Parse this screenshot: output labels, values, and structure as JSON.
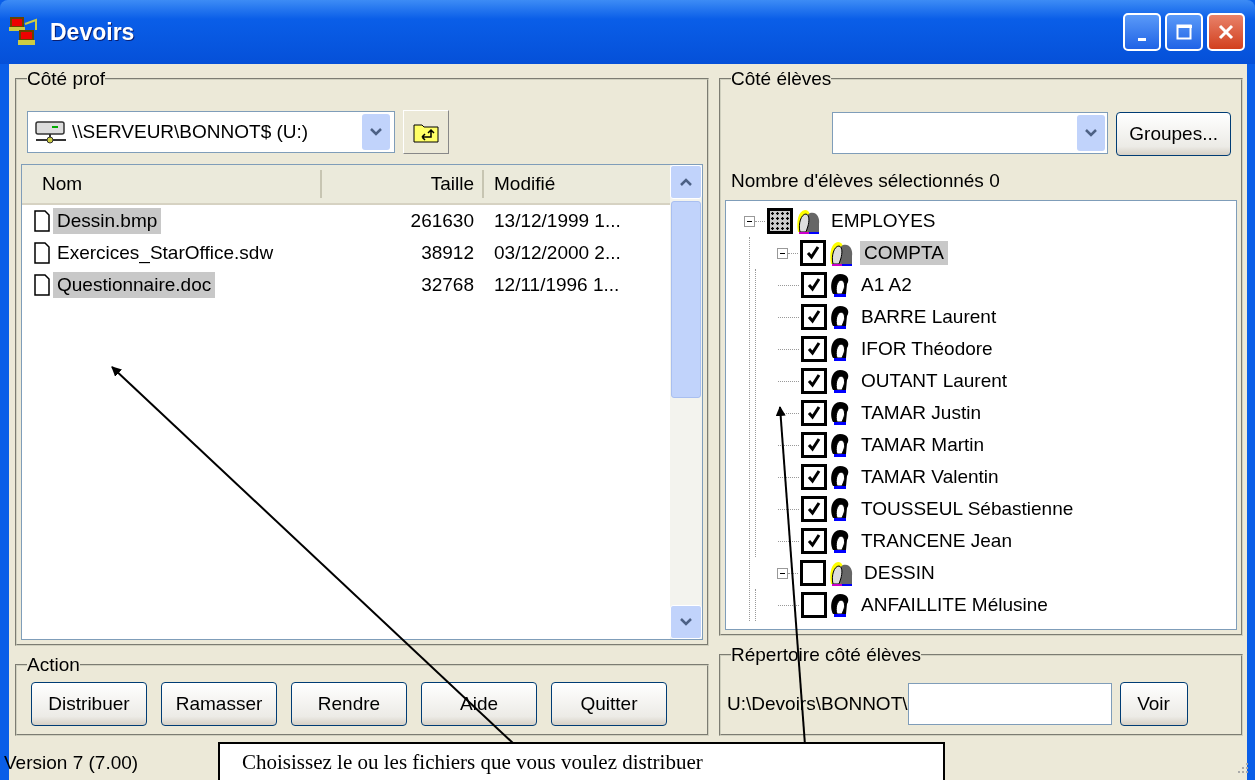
{
  "window": {
    "title": "Devoirs"
  },
  "teacher_side": {
    "title": "Côté prof",
    "drive": "\\\\SERVEUR\\BONNOT$ (U:)",
    "columns": [
      "Nom",
      "Taille",
      "Modifié"
    ],
    "files": [
      {
        "name": "Dessin.bmp",
        "size": "261630",
        "modified": "13/12/1999 1...",
        "selected": true
      },
      {
        "name": "Exercices_StarOffice.sdw",
        "size": "38912",
        "modified": "03/12/2000 2...",
        "selected": false
      },
      {
        "name": "Questionnaire.doc",
        "size": "32768",
        "modified": "12/11/1996 1...",
        "selected": true
      }
    ]
  },
  "action": {
    "title": "Action",
    "buttons": [
      "Distribuer",
      "Ramasser",
      "Rendre",
      "Aide",
      "Quitter"
    ]
  },
  "student_side": {
    "title": "Côté élèves",
    "groups_button": "Groupes...",
    "selected_count_label": "Nombre d'élèves sélectionnés 0",
    "tree": [
      {
        "label": "EMPLOYES",
        "kind": "group",
        "checked": false,
        "mixed": true,
        "selected": false,
        "expanded": true,
        "children": [
          {
            "label": "COMPTA",
            "kind": "group",
            "checked": true,
            "mixed": false,
            "selected": true,
            "expanded": true,
            "children": [
              {
                "label": "A1 A2",
                "kind": "person",
                "checked": true,
                "mixed": false,
                "selected": false
              },
              {
                "label": "BARRE Laurent",
                "kind": "person",
                "checked": true,
                "mixed": false,
                "selected": false
              },
              {
                "label": "IFOR Théodore",
                "kind": "person",
                "checked": true,
                "mixed": false,
                "selected": false
              },
              {
                "label": "OUTANT Laurent",
                "kind": "person",
                "checked": true,
                "mixed": false,
                "selected": false
              },
              {
                "label": "TAMAR Justin",
                "kind": "person",
                "checked": true,
                "mixed": false,
                "selected": false
              },
              {
                "label": "TAMAR Martin",
                "kind": "person",
                "checked": true,
                "mixed": false,
                "selected": false
              },
              {
                "label": "TAMAR Valentin",
                "kind": "person",
                "checked": true,
                "mixed": false,
                "selected": false
              },
              {
                "label": "TOUSSEUL Sébastienne",
                "kind": "person",
                "checked": true,
                "mixed": false,
                "selected": false
              },
              {
                "label": "TRANCENE Jean",
                "kind": "person",
                "checked": true,
                "mixed": false,
                "selected": false
              }
            ]
          },
          {
            "label": "DESSIN",
            "kind": "group",
            "checked": false,
            "mixed": false,
            "selected": false,
            "expanded": true,
            "children": [
              {
                "label": "ANFAILLITE Mélusine",
                "kind": "person",
                "checked": false,
                "mixed": false,
                "selected": false
              }
            ]
          }
        ]
      }
    ]
  },
  "student_directory": {
    "title": "Répertoire côté élèves",
    "path_prefix": "U:\\Devoirs\\BONNOT\\",
    "button": "Voir"
  },
  "status_bar": {
    "version": "Version 7 (7.00)"
  },
  "callout": {
    "text": "Choisissez le ou les fichiers que vous voulez distribuer"
  }
}
